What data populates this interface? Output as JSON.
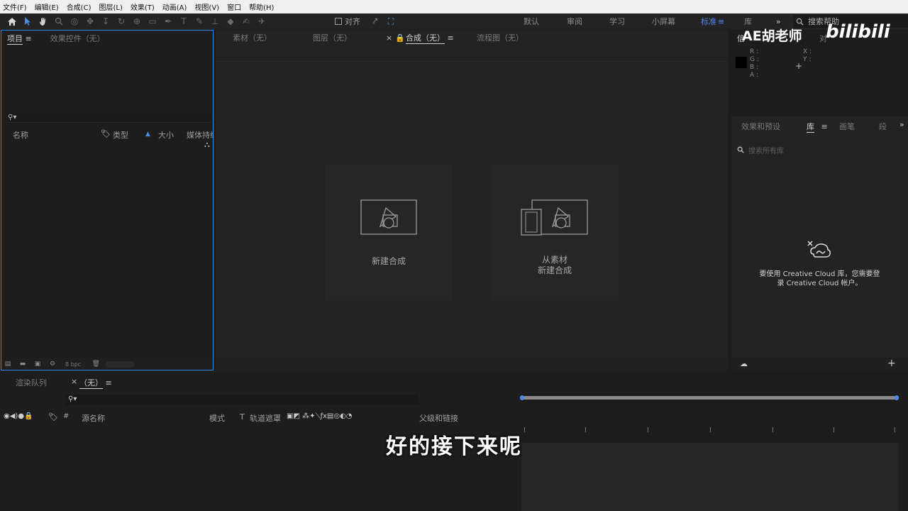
{
  "menu": [
    "文件(F)",
    "编辑(E)",
    "合成(C)",
    "图层(L)",
    "效果(T)",
    "动画(A)",
    "视图(V)",
    "窗口",
    "帮助(H)"
  ],
  "toolbar": {
    "align_label": "对齐",
    "workspaces": [
      "默认",
      "审阅",
      "学习",
      "小屏幕",
      "标准",
      "库"
    ],
    "active_workspace": "标准",
    "search_help": "搜索帮助"
  },
  "project_panel": {
    "tab_project": "项目",
    "tab_effects": "效果控件（无）",
    "columns": [
      "名称",
      "类型",
      "大小",
      "媒体持续"
    ],
    "bpc": "8 bpc"
  },
  "comp_panel": {
    "tabs": [
      "素材（无）",
      "图层（无）",
      "合成（无）",
      "流程图（无）"
    ],
    "active_tab": "合成（无）",
    "new_comp": "新建合成",
    "from_footage_line1": "从素材",
    "from_footage_line2": "新建合成"
  },
  "info_panel": {
    "tab": "信",
    "tab2": "对",
    "labels": [
      "R :",
      "G :",
      "B :",
      "A :"
    ],
    "xy": [
      "X :",
      "Y :"
    ]
  },
  "library_panel": {
    "tabs": [
      "效果和预设",
      "库",
      "画笔",
      "段"
    ],
    "active_tab": "库",
    "search_placeholder": "搜索所有库",
    "message_line1": "要使用 Creative Cloud 库，您需要登",
    "message_line2": "录 Creative Cloud 帐户。"
  },
  "timeline": {
    "tab_render": "渲染队列",
    "tab_comp": "（无）",
    "columns": [
      "#",
      "源名称",
      "模式",
      "T",
      "轨道遮罩",
      "父级和链接"
    ]
  },
  "overlay": {
    "subtitle": "好的接下来呢",
    "watermark": "AE胡老师",
    "logo": "bilibili"
  },
  "colors": {
    "accent": "#2d8ceb",
    "active_workspace": "#4d8be8",
    "background": "#1d1d1d",
    "menubar": "#f0f0f0"
  }
}
